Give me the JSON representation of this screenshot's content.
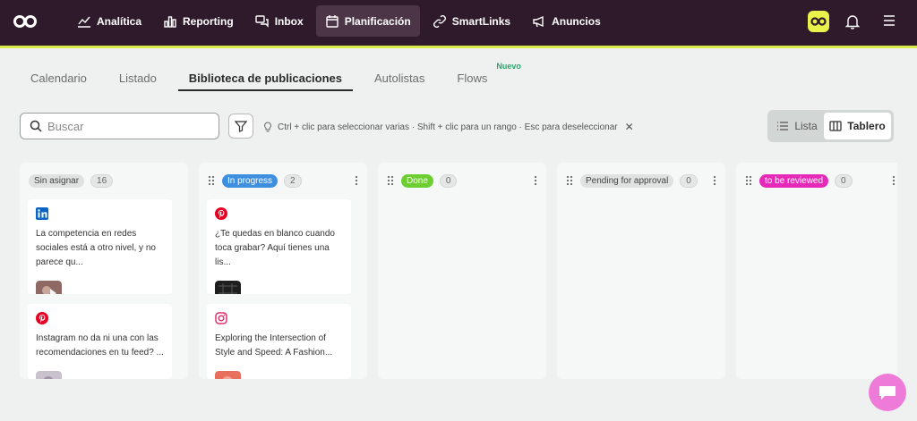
{
  "nav": {
    "items": [
      {
        "label": "Analítica",
        "icon": "chart-line-icon"
      },
      {
        "label": "Reporting",
        "icon": "bar-chart-icon"
      },
      {
        "label": "Inbox",
        "icon": "chat-bubbles-icon"
      },
      {
        "label": "Planificación",
        "icon": "calendar-icon",
        "active": true
      },
      {
        "label": "SmartLinks",
        "icon": "link-icon"
      },
      {
        "label": "Anuncios",
        "icon": "megaphone-icon"
      }
    ],
    "colors": {
      "bar": "#2e1a2a",
      "accent": "#d7ea4a",
      "avatar": "#e8f24a"
    }
  },
  "tabs": {
    "items": [
      "Calendario",
      "Listado",
      "Biblioteca de publicaciones",
      "Autolistas",
      "Flows"
    ],
    "active": "Biblioteca de publicaciones",
    "new_badge": "Nuevo"
  },
  "toolbar": {
    "search_placeholder": "Buscar",
    "hint": "Ctrl + clic para seleccionar varias · Shift + clic para un rango · Esc para deseleccionar",
    "close": "✕",
    "view_list": "Lista",
    "view_board": "Tablero"
  },
  "columns": [
    {
      "status": "Sin asignar",
      "count": "16",
      "color": "#dfe2e1",
      "text_color": "#444444"
    },
    {
      "status": "In progress",
      "count": "2",
      "color": "#3f8fe0",
      "text_color": "#ffffff"
    },
    {
      "status": "Done",
      "count": "0",
      "color": "#6ccf2f",
      "text_color": "#ffffff"
    },
    {
      "status": "Pending for approval",
      "count": "0",
      "color": "#dfe2e1",
      "text_color": "#444444"
    },
    {
      "status": "to be reviewed",
      "count": "0",
      "color": "#e629b8",
      "text_color": "#ffffff"
    }
  ],
  "cards": {
    "col0": [
      {
        "network": "linkedin-icon",
        "text": "La competencia en redes sociales está a otro nivel, y no parece qu..."
      },
      {
        "network": "pinterest-icon",
        "text": "Instagram no da ni una con las recomendaciones en tu feed? ..."
      }
    ],
    "col1": [
      {
        "network": "pinterest-icon",
        "text": "¿Te quedas en blanco cuando toca grabar? Aquí tienes una lis..."
      },
      {
        "network": "instagram-icon",
        "text": "Exploring the Intersection of Style and Speed: A Fashion..."
      }
    ]
  }
}
